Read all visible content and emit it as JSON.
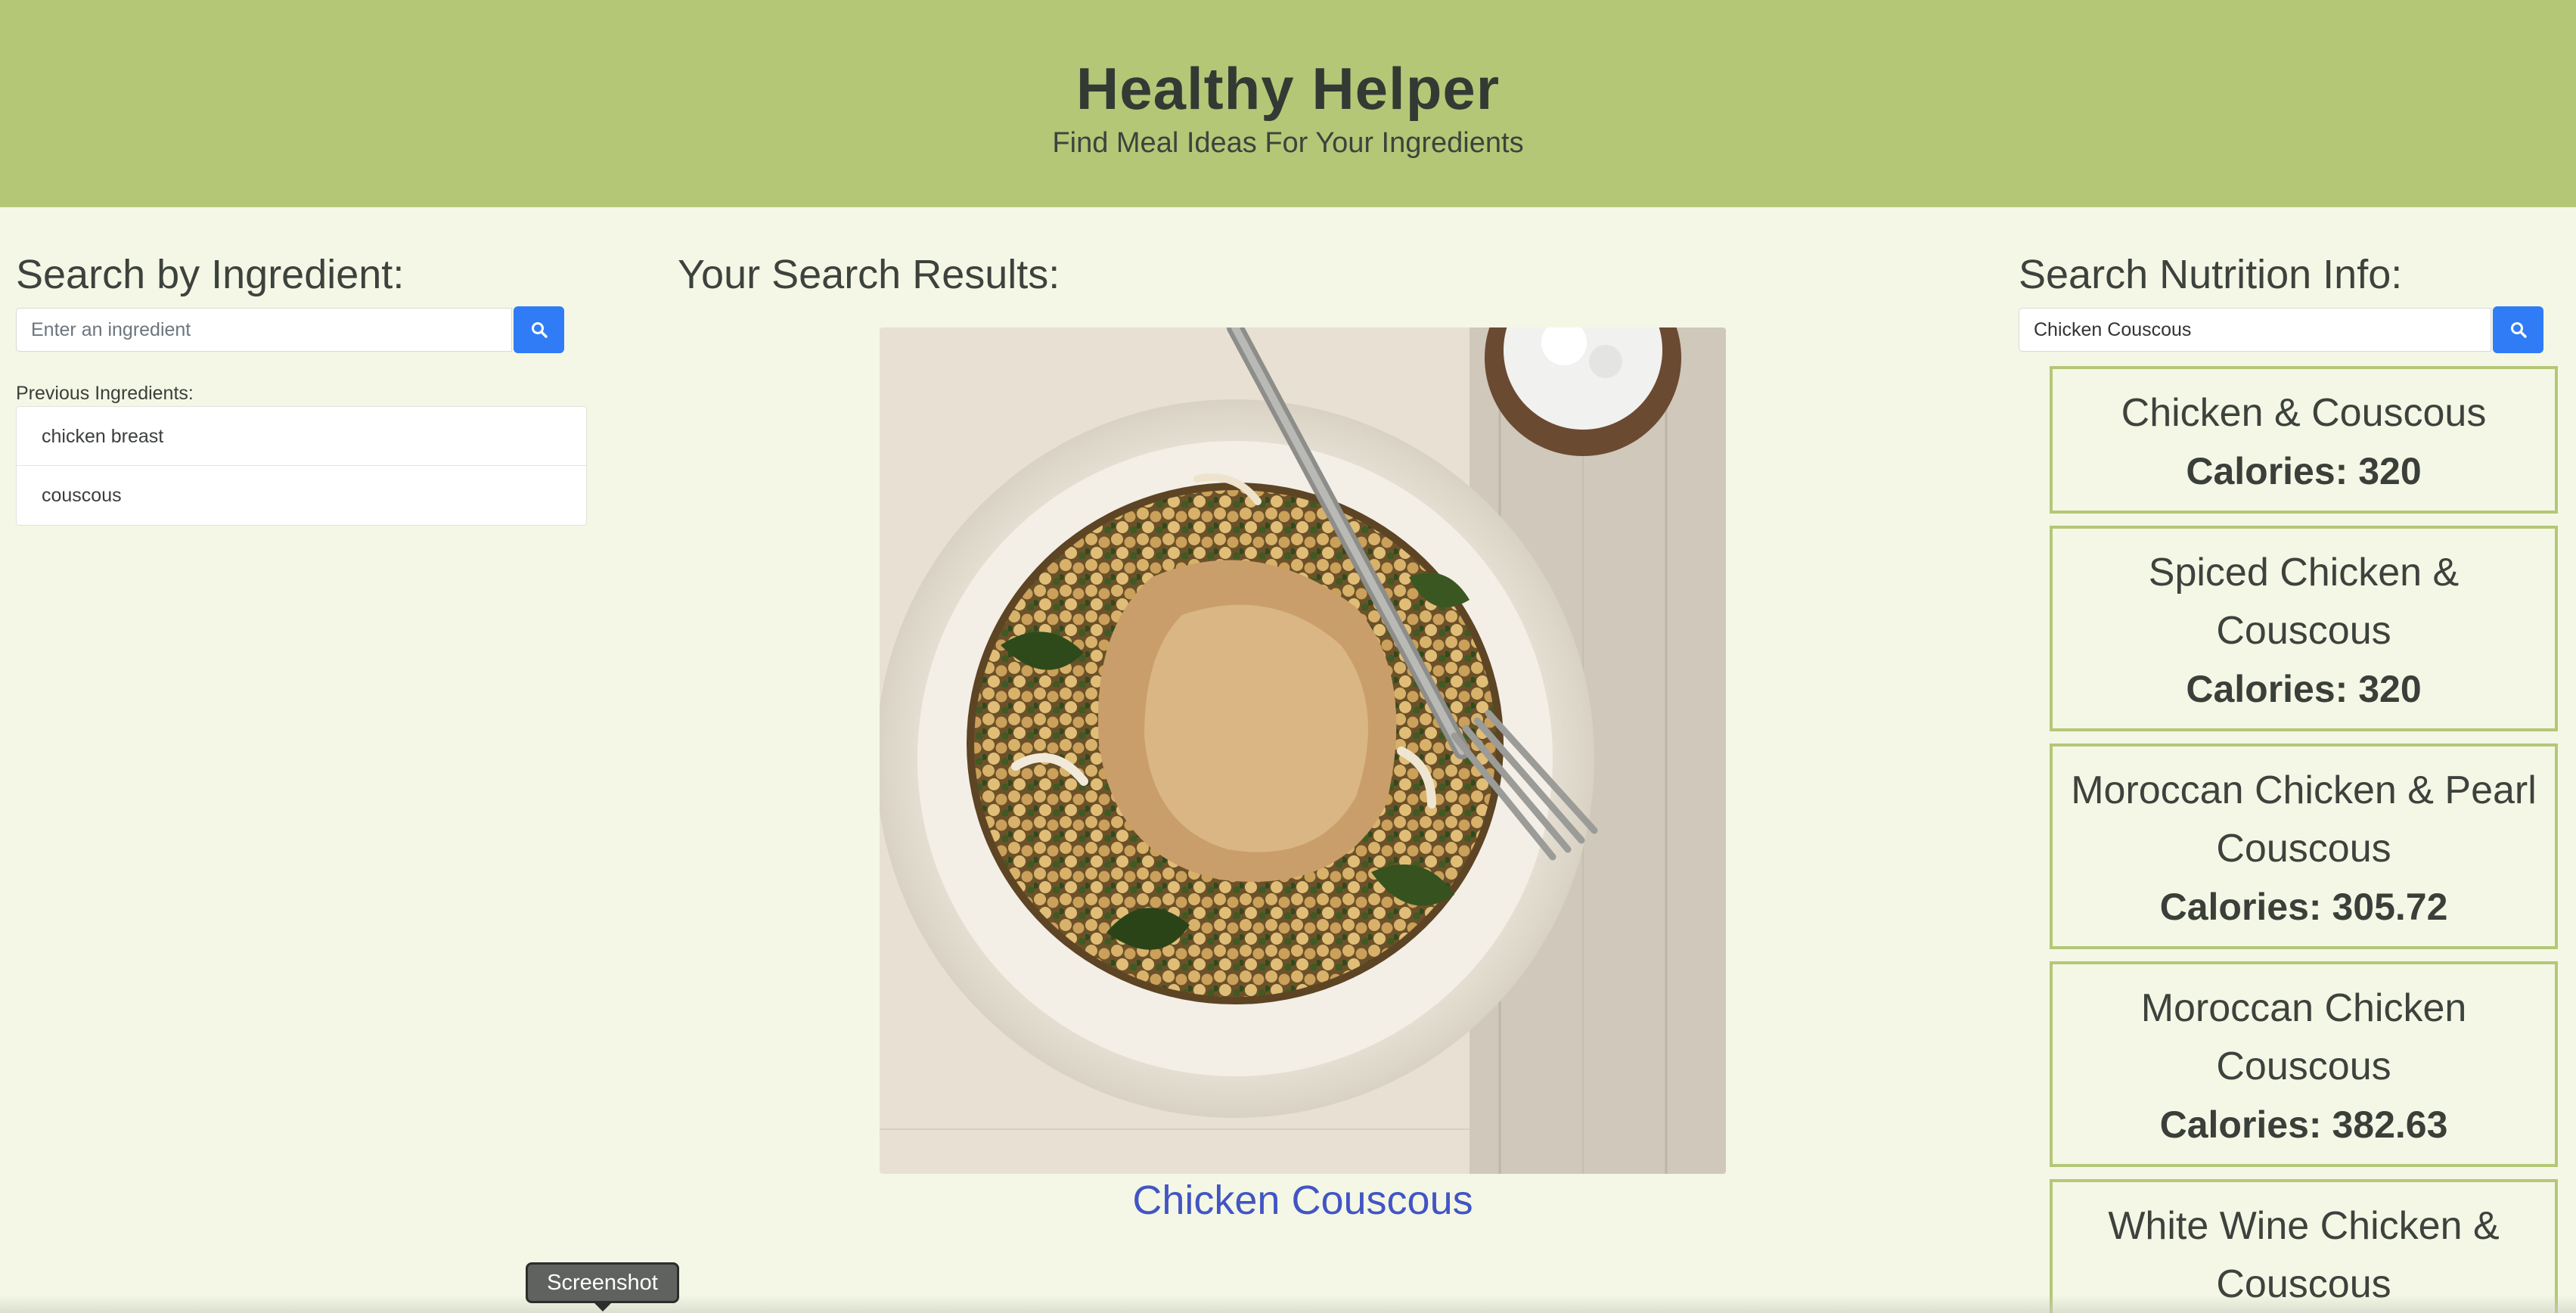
{
  "header": {
    "title": "Healthy Helper",
    "subtitle": "Find Meal Ideas For Your Ingredients"
  },
  "ingredient_search": {
    "heading": "Search by Ingredient:",
    "placeholder": "Enter an ingredient",
    "value": "",
    "button_icon": "search-icon",
    "previous_label": "Previous Ingredients:",
    "previous": [
      "chicken breast",
      "couscous"
    ]
  },
  "results": {
    "heading": "Your Search Results:",
    "image_alt": "chicken-couscous-photo",
    "recipe_title": "Chicken Couscous"
  },
  "nutrition_search": {
    "heading": "Search Nutrition Info:",
    "placeholder": "",
    "value": "Chicken Couscous",
    "button_icon": "search-icon",
    "items": [
      {
        "name": "Chicken & Couscous",
        "calories": "Calories: 320"
      },
      {
        "name": "Spiced Chicken & Couscous",
        "calories": "Calories: 320"
      },
      {
        "name": "Moroccan Chicken & Pearl Couscous",
        "calories": "Calories: 305.72"
      },
      {
        "name": "Moroccan Chicken Couscous",
        "calories": "Calories: 382.63"
      },
      {
        "name": "White Wine Chicken & Couscous",
        "calories": ""
      }
    ]
  },
  "tooltip": {
    "text": "Screenshot"
  },
  "colors": {
    "header_bg": "#b4c777",
    "page_bg": "#f4f7e5",
    "button": "#2f7cf6",
    "link": "#4255c4",
    "card_border": "#b4c777"
  }
}
